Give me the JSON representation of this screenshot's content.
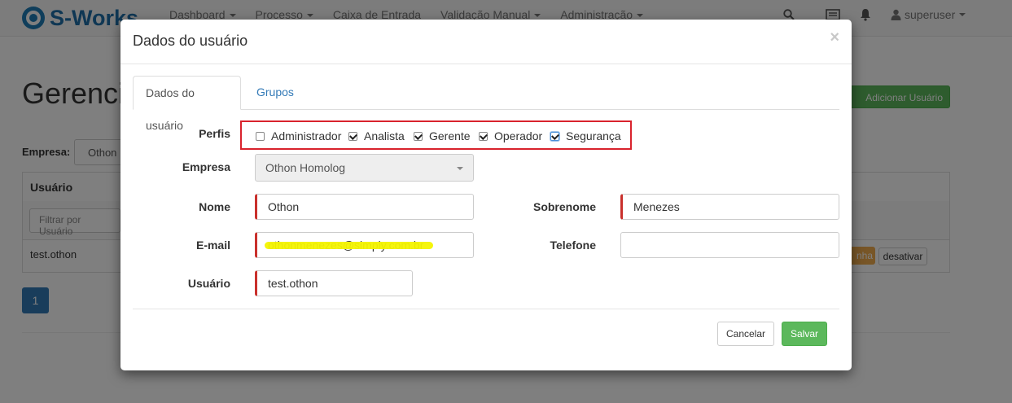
{
  "navbar": {
    "brand": "S-Works",
    "menu": [
      {
        "label": "Dashboard",
        "dropdown": true
      },
      {
        "label": "Processo",
        "dropdown": true
      },
      {
        "label": "Caixa de Entrada",
        "dropdown": false
      },
      {
        "label": "Validação Manual",
        "dropdown": true
      },
      {
        "label": "Administração",
        "dropdown": true
      }
    ],
    "user": "superuser"
  },
  "page": {
    "title": "Gerencia",
    "add_user_label": "Adicionar Usuário",
    "company_label": "Empresa:",
    "company_value": "Othon I",
    "table": {
      "header_user": "Usuário",
      "filter_placeholder": "Filtrar por Usuário",
      "rows": [
        {
          "user": "test.othon",
          "action_partial": "nha",
          "deactivate": "desativar"
        }
      ]
    },
    "pagination": {
      "current": "1"
    }
  },
  "modal": {
    "title": "Dados do usuário",
    "close": "×",
    "tabs": [
      {
        "label": "Dados do usuário",
        "active": true
      },
      {
        "label": "Grupos",
        "active": false
      }
    ],
    "profiles_label": "Perfis",
    "profiles": [
      {
        "label": "Administrador",
        "checked": false
      },
      {
        "label": "Analista",
        "checked": true
      },
      {
        "label": "Gerente",
        "checked": true
      },
      {
        "label": "Operador",
        "checked": true
      },
      {
        "label": "Segurança",
        "checked": true
      }
    ],
    "company_label": "Empresa",
    "company_value": "Othon Homolog",
    "first_name_label": "Nome",
    "first_name_value": "Othon",
    "last_name_label": "Sobrenome",
    "last_name_value": "Menezes",
    "email_label": "E-mail",
    "email_value": "othonmenezes@simply.com.br",
    "phone_label": "Telefone",
    "phone_value": "",
    "username_label": "Usuário",
    "username_value": "test.othon",
    "cancel_label": "Cancelar",
    "save_label": "Salvar"
  },
  "colors": {
    "primary": "#337ab7",
    "success": "#5cb85c",
    "required_marker": "#c9302c",
    "highlight_box": "#d9232d"
  }
}
